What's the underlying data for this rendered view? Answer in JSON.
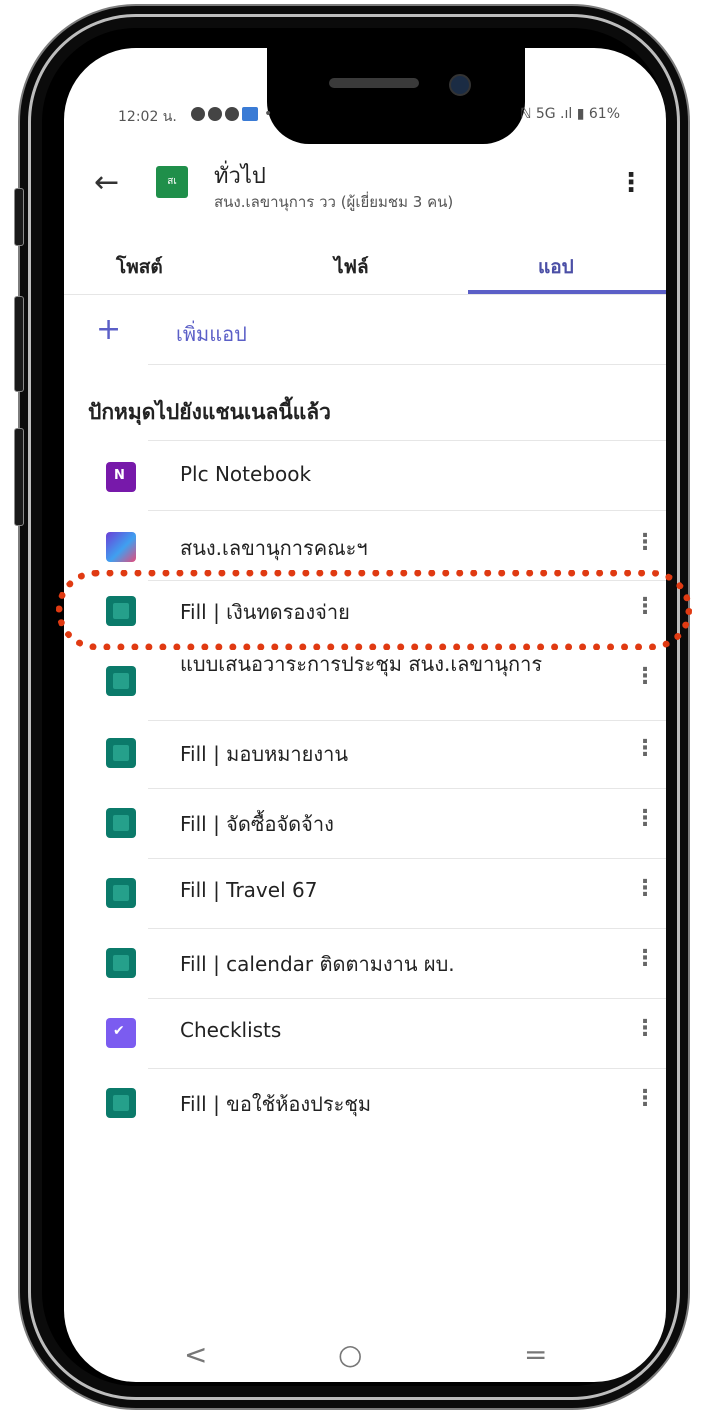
{
  "status_bar": {
    "time": "12:02 น.",
    "right": "ℕ 5G .ıl ▮ 61%"
  },
  "header": {
    "back_icon": "arrow-left-icon",
    "team_avatar": "สเ",
    "title": "ทั่วไป",
    "subtitle": "สนง.เลขานุการ วว (ผู้เยี่ยมชม 3 คน)",
    "more_icon": "more-vertical-icon"
  },
  "tabs": [
    {
      "label": "โพสต์",
      "active": false
    },
    {
      "label": "ไฟล์",
      "active": false
    },
    {
      "label": "แอป",
      "active": true
    }
  ],
  "add_app": {
    "label": "เพิ่มแอป"
  },
  "section_title": "ปักหมุดไปยังแชนเนลนี้แล้ว",
  "apps": [
    {
      "label": "Plc Notebook",
      "icon": "onenote-icon",
      "has_more": false
    },
    {
      "label": "สนง.เลขานุการคณะฯ",
      "icon": "power-apps-icon",
      "has_more": true
    },
    {
      "label": "Fill | เงินทดรองจ่าย",
      "icon": "forms-icon",
      "has_more": true,
      "highlighted": true
    },
    {
      "label": "แบบเสนอวาระการประชุม สนง.เลขานุการ",
      "icon": "forms-icon",
      "has_more": true
    },
    {
      "label": "Fill | มอบหมายงาน",
      "icon": "forms-icon",
      "has_more": true
    },
    {
      "label": "Fill | จัดซื้อจัดจ้าง",
      "icon": "forms-icon",
      "has_more": true
    },
    {
      "label": "Fill | Travel 67",
      "icon": "forms-icon",
      "has_more": true
    },
    {
      "label": "Fill | calendar ติดตามงาน ผบ.",
      "icon": "forms-icon",
      "has_more": true
    },
    {
      "label": "Checklists",
      "icon": "checklists-icon",
      "has_more": true
    },
    {
      "label": "Fill | ขอใช้ห้องประชุม",
      "icon": "forms-icon",
      "has_more": true
    }
  ],
  "nav_bar": {
    "back": "<",
    "home": "○",
    "recents": "="
  },
  "colors": {
    "accent": "#5b5fc7",
    "highlight": "#e03a12",
    "forms": "#0b7a6a"
  }
}
